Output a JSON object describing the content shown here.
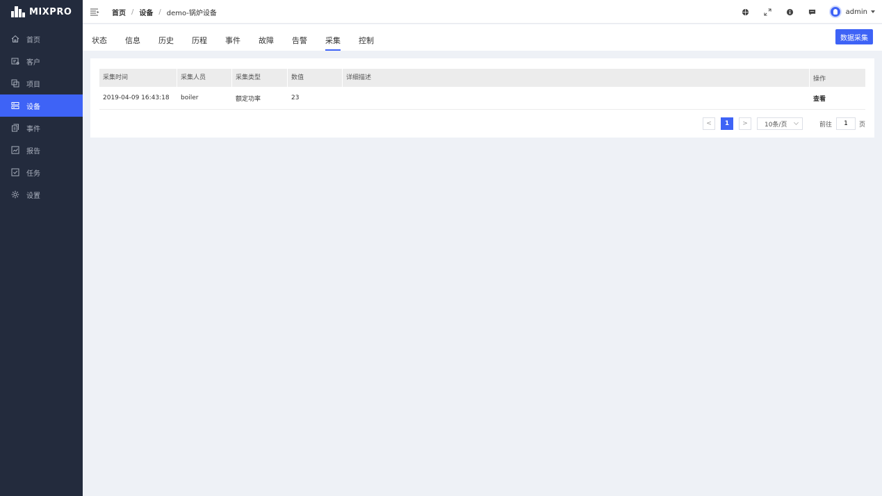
{
  "app": {
    "logo_text": "MIXPRO"
  },
  "sidebar": {
    "items": [
      {
        "label": "首页",
        "icon": "home-icon",
        "active": false
      },
      {
        "label": "客户",
        "icon": "customer-icon",
        "active": false
      },
      {
        "label": "项目",
        "icon": "project-icon",
        "active": false
      },
      {
        "label": "设备",
        "icon": "device-icon",
        "active": true
      },
      {
        "label": "事件",
        "icon": "event-icon",
        "active": false
      },
      {
        "label": "报告",
        "icon": "report-icon",
        "active": false
      },
      {
        "label": "任务",
        "icon": "task-icon",
        "active": false
      },
      {
        "label": "设置",
        "icon": "settings-icon",
        "active": false
      }
    ]
  },
  "header": {
    "breadcrumb": [
      "首页",
      "设备",
      "demo-锅炉设备"
    ],
    "separator": "/",
    "user": "admin"
  },
  "tabs": {
    "items": [
      "状态",
      "信息",
      "历史",
      "历程",
      "事件",
      "故障",
      "告警",
      "采集",
      "控制"
    ],
    "active": "采集",
    "action_button": "数据采集"
  },
  "table": {
    "columns": [
      "采集时间",
      "采集人员",
      "采集类型",
      "数值",
      "详细描述",
      "操作"
    ],
    "rows": [
      {
        "time": "2019-04-09 16:43:18",
        "person": "boiler",
        "type": "额定功率",
        "value": "23",
        "desc": "",
        "action": "查看"
      }
    ]
  },
  "pagination": {
    "current_page": "1",
    "page_size": "10条/页",
    "goto_label": "前往",
    "goto_value": "1",
    "goto_suffix": "页",
    "prev": "<",
    "next": ">"
  },
  "colors": {
    "accent": "#3e63f6",
    "sidebar_bg": "#232b3d",
    "page_bg": "#eef1f6"
  }
}
